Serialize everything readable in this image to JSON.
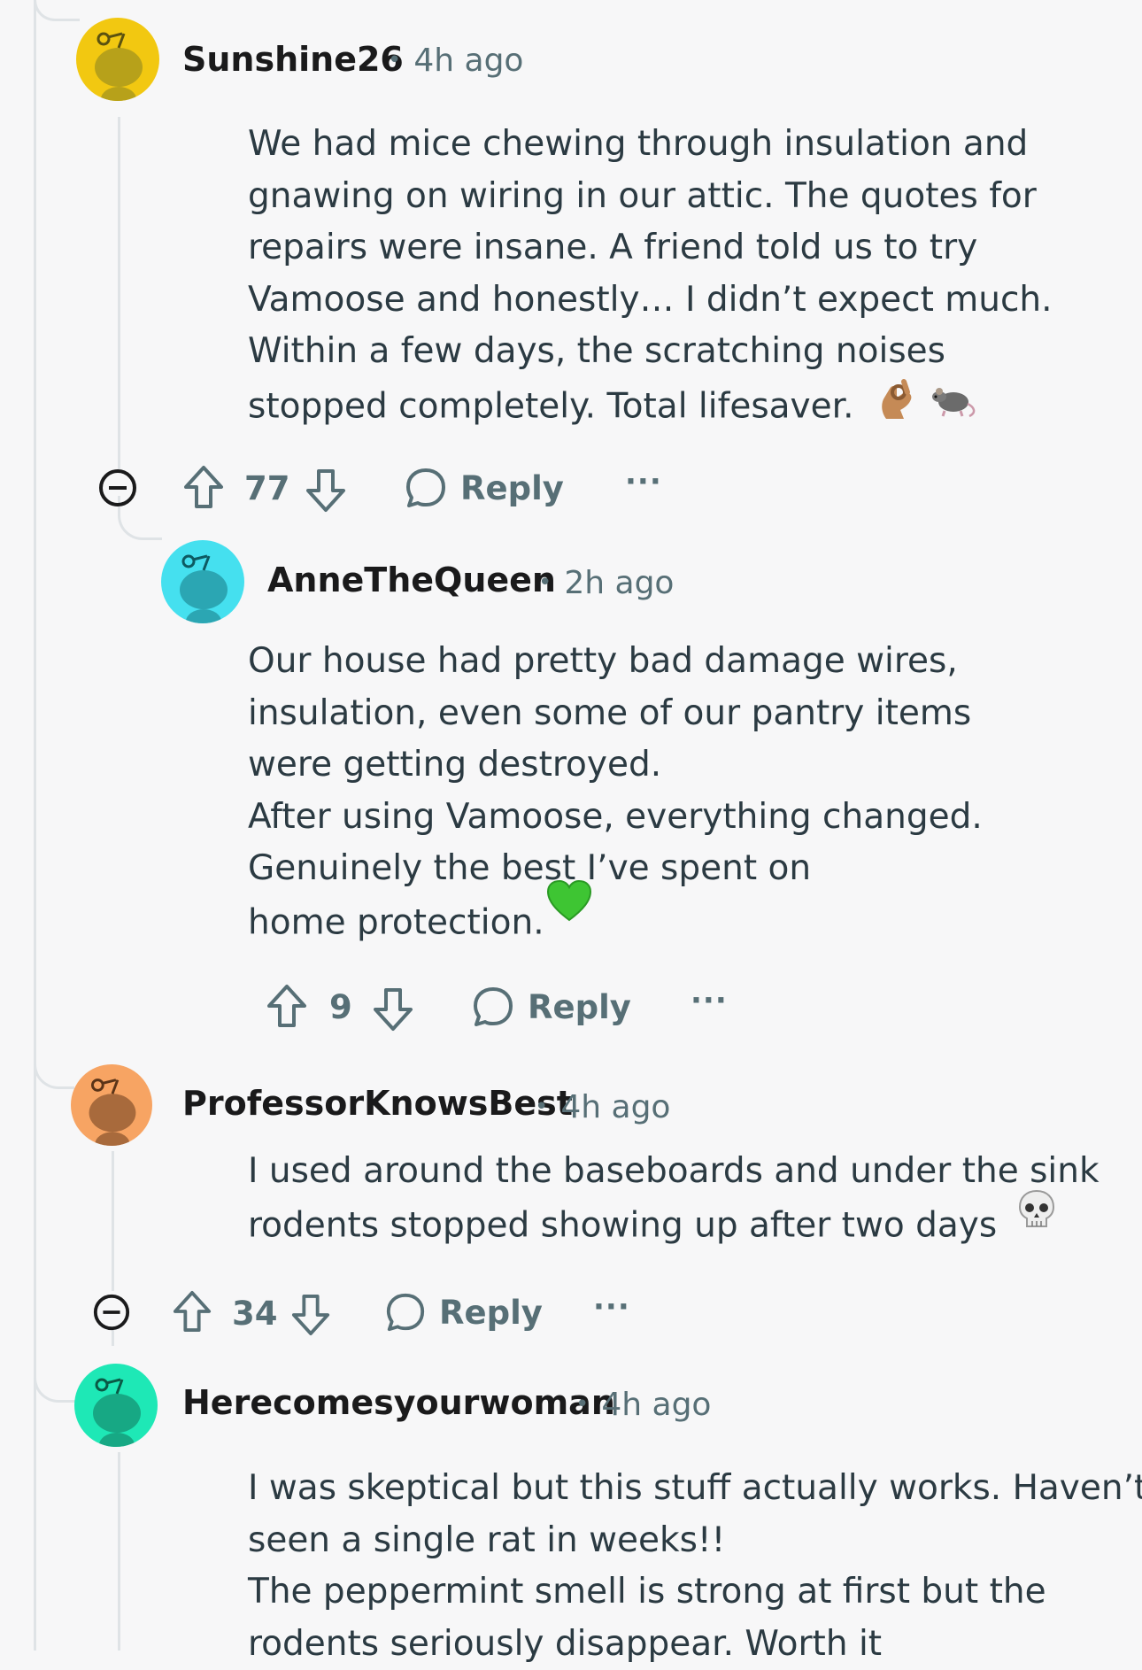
{
  "comments": [
    {
      "username": "Sunshine26",
      "time": "4h ago",
      "avatar_color": "#f2c811",
      "body": [
        "We had mice chewing through insulation and",
        "gnawing on wiring in our attic. The quotes for",
        "repairs were insane. A friend told us to try",
        "Vamoose and honestly… I didn’t expect much.",
        "Within a few days, the scratching noises",
        "stopped completely. Total lifesaver."
      ],
      "emojis": [
        "ok-hand-emoji",
        "rat-emoji"
      ],
      "votes": "77",
      "reply_label": "Reply",
      "more_label": "···"
    },
    {
      "username": "AnneTheQueen",
      "time": "2h ago",
      "avatar_color": "#45e0ef",
      "body": [
        "Our house had pretty bad damage wires,",
        "insulation, even some of our pantry items",
        "were getting destroyed.",
        "After using Vamoose, everything changed.",
        "Genuinely the best I’ve spent on",
        "home protection."
      ],
      "emojis": [
        "green-heart-emoji"
      ],
      "votes": "9",
      "reply_label": "Reply",
      "more_label": "···"
    },
    {
      "username": "ProfessorKnowsBest",
      "time": "4h ago",
      "avatar_color": "#f7a463",
      "body": [
        "I used around the baseboards and under the sink",
        "rodents stopped showing up after two days"
      ],
      "emojis": [
        "skull-emoji"
      ],
      "votes": "34",
      "reply_label": "Reply",
      "more_label": "···"
    },
    {
      "username": "Herecomesyourwoman",
      "time": "4h ago",
      "avatar_color": "#1ee8b6",
      "body": [
        "I was skeptical but this stuff actually works. Haven’t",
        "seen a single rat in weeks!!",
        "The peppermint smell is strong at first but the",
        "rodents seriously disappear. Worth it"
      ]
    }
  ],
  "separator": "•"
}
